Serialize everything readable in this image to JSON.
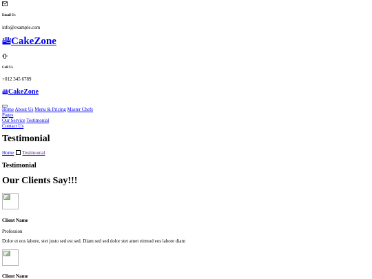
{
  "topbar": {
    "email": {
      "icon": "envelope-icon",
      "label": "Email Us",
      "value": "info@example.com"
    },
    "phone": {
      "icon": "phone-vibrate-icon",
      "label": "Call Us",
      "value": "+012 345 6789"
    }
  },
  "brand": {
    "icon": "cake-icon",
    "name": "CakeZone"
  },
  "nav": {
    "items": [
      "Home",
      "About Us",
      "Menu & Pricing",
      "Master Chefs",
      "Pages",
      "Our Service",
      "Testimonial",
      "Contact Us"
    ]
  },
  "page_header": {
    "title": "Testimonial",
    "breadcrumb": {
      "home": "Home",
      "current": "Testimonial"
    }
  },
  "section": {
    "subtitle": "Testimonial",
    "title": "Our Clients Say!!!"
  },
  "testimonials": [
    {
      "name": "Client Name",
      "profession": "Profession",
      "text": "Dolor et eos labore, stet justo sed est sed. Diam sed sed dolor stet amet eirmod eos labore diam"
    },
    {
      "name": "Client Name"
    }
  ]
}
